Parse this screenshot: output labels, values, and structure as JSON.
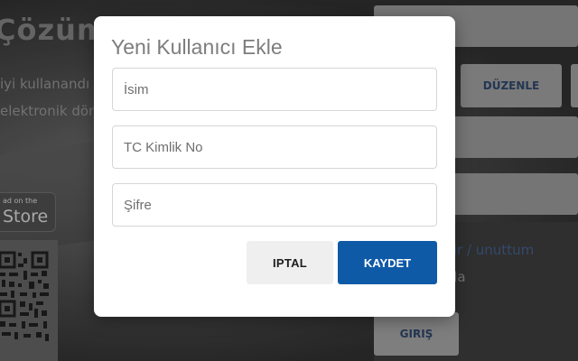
{
  "background": {
    "headline": "Çözüm",
    "line1": "iyi kullanandı",
    "line2": "elektronik dön",
    "store_small": "ad on the",
    "store_big": "Store",
    "edit_button": "DÜZENLE",
    "link_text": "ıştir / unuttum",
    "remember_text": "rla",
    "login_button": "GIRIŞ"
  },
  "modal": {
    "title": "Yeni Kullanıcı Ekle",
    "fields": {
      "name_placeholder": "İsim",
      "tc_placeholder": "TC Kimlik No",
      "password_placeholder": "Şifre"
    },
    "buttons": {
      "cancel": "IPTAL",
      "save": "KAYDET"
    }
  },
  "colors": {
    "primary": "#0e5aa7",
    "secondary_button": "#efefef",
    "title": "#7d7d7d"
  }
}
